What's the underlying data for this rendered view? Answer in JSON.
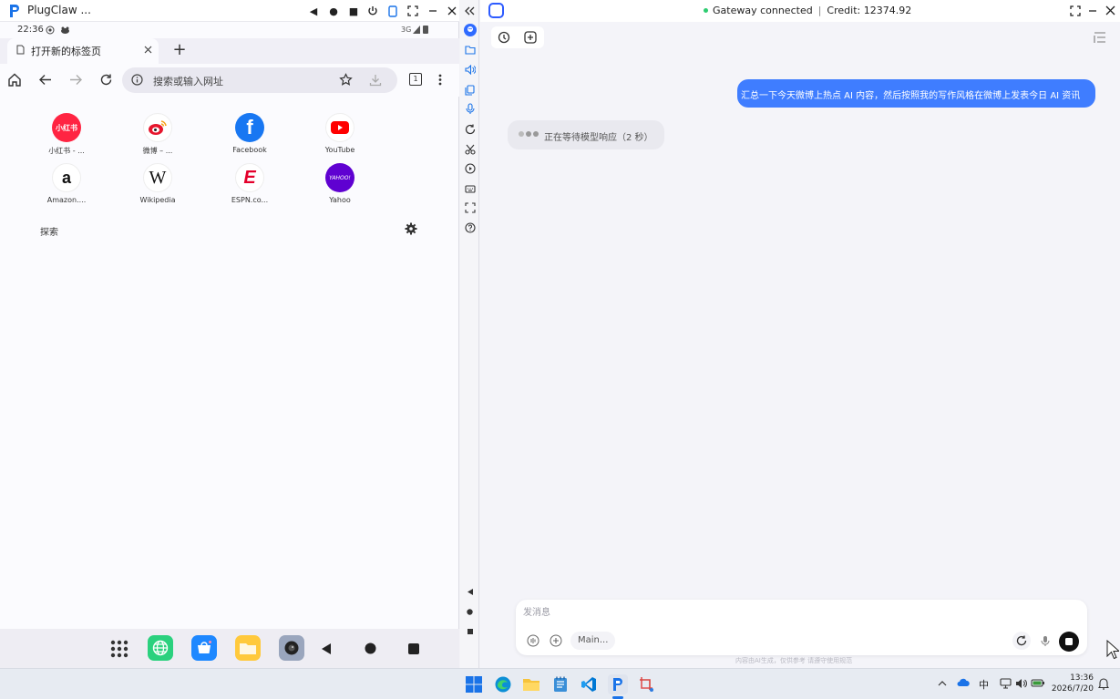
{
  "left_window": {
    "title": "PlugClaw ...",
    "status_time": "22:36",
    "network": "3G",
    "tab_title": "打开新的标签页",
    "new_tab": "+",
    "omnibox_placeholder": "搜索或输入网址",
    "tab_count": "1",
    "shortcuts": [
      {
        "label": "小红书 - ...",
        "icon": "xiaohongshu-icon",
        "icon_text": "小红书"
      },
      {
        "label": "微博 – ...",
        "icon": "weibo-icon"
      },
      {
        "label": "Facebook",
        "icon": "facebook-icon",
        "icon_text": "f"
      },
      {
        "label": "YouTube",
        "icon": "youtube-icon"
      },
      {
        "label": "Amazon....",
        "icon": "amazon-icon",
        "icon_text": "a"
      },
      {
        "label": "Wikipedia",
        "icon": "wikipedia-icon",
        "icon_text": "W"
      },
      {
        "label": "ESPN.co...",
        "icon": "espn-icon",
        "icon_text": "E"
      },
      {
        "label": "Yahoo",
        "icon": "yahoo-icon",
        "icon_text": "YAHOO!"
      }
    ],
    "explore_label": "探索"
  },
  "right_window": {
    "gateway_status": "Gateway connected",
    "credit_label": "Credit:",
    "credit_value": "12374.92",
    "user_message": "汇总一下今天微博上热点 AI 内容，然后按照我的写作风格在微博上发表今日 AI 资讯",
    "thinking_text": "正在等待模型响应（2 秒）",
    "composer_placeholder": "发消息",
    "model_label": "Main...",
    "footer_note": "内容由AI生成，仅供参考    请遵守使用规范"
  },
  "taskbar": {
    "ime": "中",
    "clock_time": "13:36",
    "clock_date": "2026/7/20"
  },
  "colors": {
    "accent": "#3f7dff",
    "gateway_dot": "#2ecc71",
    "brand": "#2d5bff"
  }
}
